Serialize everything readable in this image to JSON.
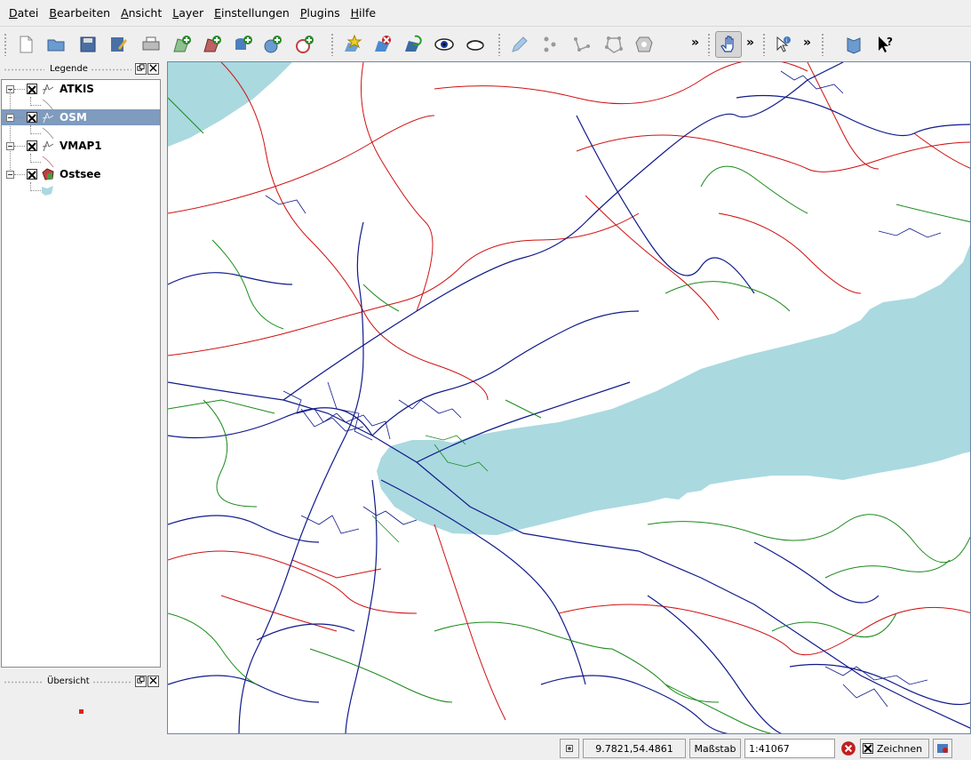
{
  "menu": [
    "Datei",
    "Bearbeiten",
    "Ansicht",
    "Layer",
    "Einstellungen",
    "Plugins",
    "Hilfe"
  ],
  "menu_accel": [
    "D",
    "B",
    "A",
    "L",
    "E",
    "P",
    "H"
  ],
  "toolbar": {
    "overflow_1": "»",
    "overflow_2": "»",
    "overflow_3": "»"
  },
  "legend": {
    "title": "Legende",
    "layers": [
      {
        "name": "ATKIS",
        "visible": true,
        "selected": false
      },
      {
        "name": "OSM",
        "visible": true,
        "selected": true
      },
      {
        "name": "VMAP1",
        "visible": true,
        "selected": false
      },
      {
        "name": "Ostsee",
        "visible": true,
        "selected": false
      }
    ]
  },
  "overview": {
    "title": "Übersicht"
  },
  "status": {
    "coordinates": "9.7821,54.4861",
    "scale_label": "Maßstab",
    "scale_value": "1:41067",
    "render_label": "Zeichnen"
  },
  "colors": {
    "water": "#aad9e0",
    "road_primary": "#d01010",
    "road_blue": "#101a8a",
    "road_green": "#1a8a1a",
    "selection": "#7f9bbd"
  }
}
